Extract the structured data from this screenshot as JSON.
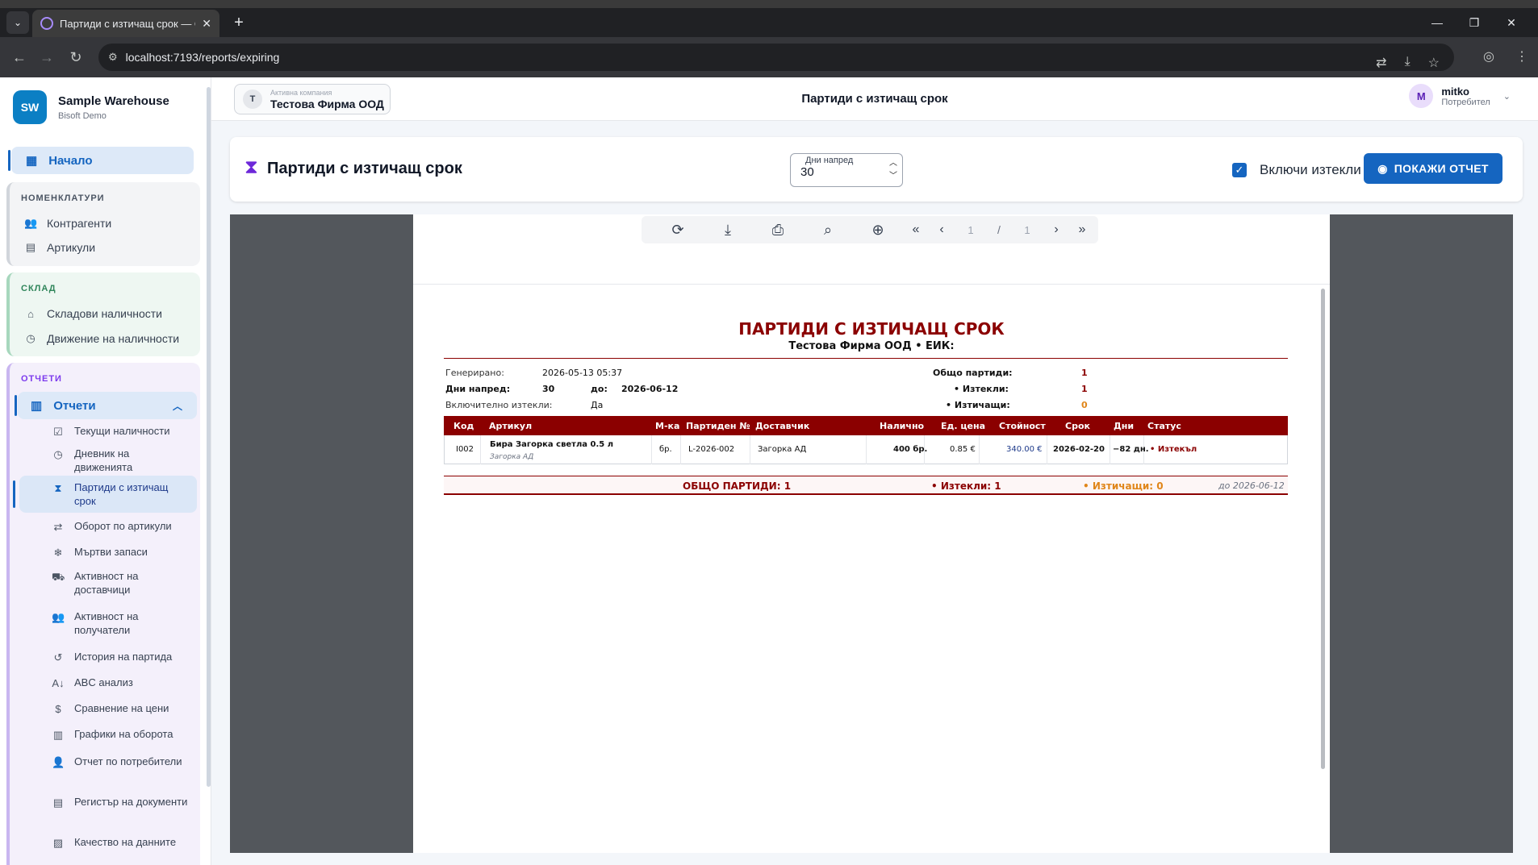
{
  "browser": {
    "tab_title": "Партиди с изтичащ срок — O",
    "url": "localhost:7193/reports/expiring"
  },
  "sidebar": {
    "brand_logo": "SW",
    "brand_name": "Sample Warehouse",
    "brand_sub": "Bisoft Demo",
    "home": "Начало",
    "groups": {
      "nomenclatures": {
        "title": "НОМЕНКЛАТУРИ",
        "items": [
          "Контрагенти",
          "Артикули"
        ]
      },
      "warehouse": {
        "title": "СКЛАД",
        "items": [
          "Складови наличности",
          "Движение на наличности"
        ]
      },
      "reports": {
        "title": "ОТЧЕТИ",
        "head": "Отчети",
        "items": [
          "Текущи наличности",
          "Дневник на движенията",
          "Партиди с изтичащ срок",
          "Оборот по артикули",
          "Мъртви запаси",
          "Активност на доставчици",
          "Активност на получатели",
          "История на партида",
          "ABC анализ",
          "Сравнение на цени",
          "Графики на оборота",
          "Отчет по потребители",
          "Регистър на документи",
          "Качество на данните"
        ]
      }
    }
  },
  "topbar": {
    "company_label": "Активна компания",
    "company_initial": "T",
    "company_name": "Тестова Фирма ООД",
    "title": "Партиди с изтичащ срок",
    "user_initial": "M",
    "user_name": "mitko",
    "user_role": "Потребител"
  },
  "report_header": {
    "title": "Партиди с изтичащ срок",
    "days_label": "Дни напред",
    "days_value": "30",
    "include_expired_label": "Включи изтекли",
    "include_expired_checked": true,
    "show_button": "ПОКАЖИ ОТЧЕТ"
  },
  "viewer": {
    "page_current": "1",
    "page_separator": "/",
    "page_total": "1"
  },
  "report": {
    "title": "ПАРТИДИ С ИЗТИЧАЩ СРОК",
    "subtitle": "Тестова Фирма ООД • ЕИК:",
    "generated_label": "Генерирано:",
    "generated_value": "2026-05-13 05:37",
    "days_label": "Дни напред:",
    "days_value": "30",
    "to_label": "до:",
    "to_value": "2026-06-12",
    "incl_label": "Включително изтекли:",
    "incl_value": "Да",
    "total_label": "Общо партиди:",
    "total_value": "1",
    "expired_label": "• Изтекли:",
    "expired_value": "1",
    "expiring_label": "• Изтичащи:",
    "expiring_value": "0",
    "columns": [
      "Код",
      "Артикул",
      "М-ка",
      "Партиден №",
      "Доставчик",
      "Налично",
      "Ед. цена",
      "Стойност",
      "Срок",
      "Дни",
      "Статус"
    ],
    "rows": [
      {
        "code": "I002",
        "article": "Бира Загорка светла 0.5 л",
        "article_sub": "Загорка АД",
        "unit": "бр.",
        "batch": "L-2026-002",
        "supplier": "Загорка АД",
        "qty": "400 бр.",
        "unit_price": "0.85 €",
        "value": "340.00 €",
        "expiry": "2026-02-20",
        "days": "−82 дн.",
        "status": "• Изтекъл"
      }
    ],
    "footer_total": "ОБЩО ПАРТИДИ: 1",
    "footer_expired": "• Изтекли: 1",
    "footer_expiring": "• Изтичащи: 0",
    "footer_to": "до 2026-06-12"
  },
  "colors": {
    "accent": "#1565c0",
    "report_red": "#8b0000",
    "orange": "#e0861a",
    "viewer_bg": "#53575c"
  }
}
